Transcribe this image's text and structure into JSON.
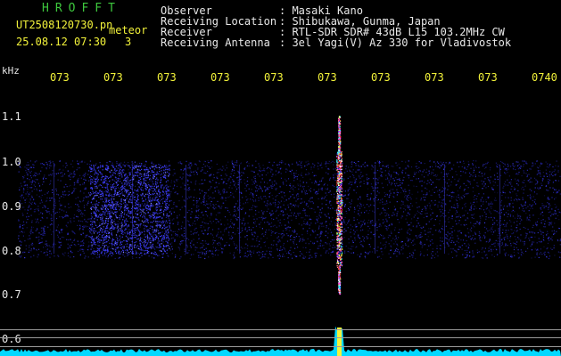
{
  "header": {
    "brand": "HROFFT",
    "filename": "UT2508120730.pn",
    "event_label": "meteor",
    "date_time": "25.08.12 07:30",
    "counter": "3",
    "fields": [
      {
        "label": "Observer",
        "value": ": Masaki Kano"
      },
      {
        "label": "Receiving Location",
        "value": ": Shibukawa, Gunma, Japan"
      },
      {
        "label": "Receiver",
        "value": ": RTL-SDR SDR# 43dB L15 103.2MHz CW"
      },
      {
        "label": "Receiving Antenna",
        "value": ": 3el Yagi(V) Az 330 for Vladivostok"
      }
    ]
  },
  "time_axis": {
    "ticks": [
      "073",
      "073",
      "073",
      "073",
      "073",
      "073",
      "073",
      "073",
      "073",
      "0740"
    ]
  },
  "freq_axis": {
    "unit": "kHz",
    "ticks": [
      "1.1",
      "1.0",
      "0.9",
      "0.8",
      "0.7",
      "0.6"
    ]
  },
  "colors": {
    "background": "#000000",
    "noise": "#2a2acc",
    "echo": "#ff4040",
    "trace": "#00e0ff",
    "brand": "#3ec83e",
    "time_labels": "#f2f23a"
  }
}
